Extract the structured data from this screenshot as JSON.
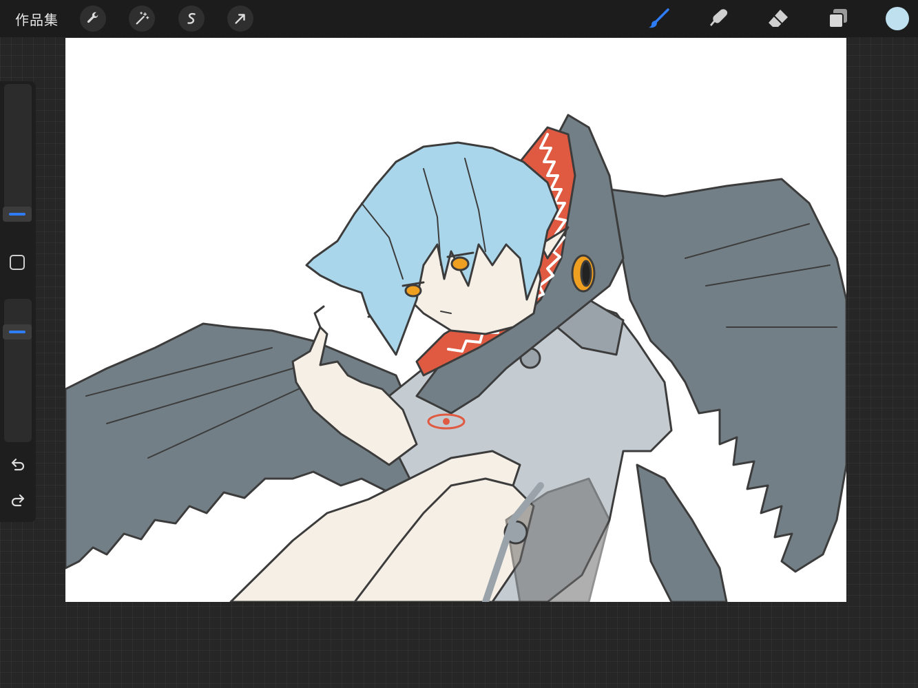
{
  "topbar": {
    "gallery_label": "作品集",
    "left_tools": [
      {
        "name": "actions",
        "icon": "wrench-icon"
      },
      {
        "name": "adjustments",
        "icon": "magic-wand-icon"
      },
      {
        "name": "selection",
        "icon": "selection-s-icon"
      },
      {
        "name": "transform",
        "icon": "arrow-cursor-icon"
      }
    ],
    "right_tools": [
      {
        "name": "brush",
        "icon": "brush-icon",
        "active": true
      },
      {
        "name": "smudge",
        "icon": "smudge-finger-icon"
      },
      {
        "name": "eraser",
        "icon": "eraser-icon"
      },
      {
        "name": "layers",
        "icon": "layers-icon"
      }
    ],
    "current_color": "#bfe0ee",
    "active_color": "#2f7df6"
  },
  "sidebar": {
    "brush_size_icon": "size-slider-icon",
    "opacity_icon": "opacity-slider-icon",
    "modify_icon": "square-icon",
    "undo_icon": "undo-icon",
    "redo_icon": "redo-icon",
    "accent": "#2f7df6"
  },
  "canvas": {
    "content": "artwork",
    "palette": {
      "hair": "#a9d6ea",
      "wing": "#737f86",
      "skin": "#f6efe6",
      "cloak": "#c5ccd1",
      "mouth": "#e05a42",
      "eye": "#f0a020",
      "line": "#3c3c3c"
    }
  }
}
